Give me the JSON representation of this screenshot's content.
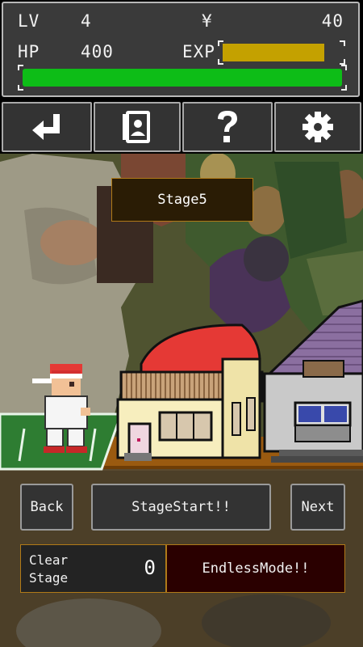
{
  "status": {
    "lv_label": "LV",
    "lv_value": "4",
    "currency_symbol": "¥",
    "gold_value": "40",
    "hp_label": "HP",
    "hp_value": "400",
    "exp_label": "EXP",
    "exp_fraction": 0.86,
    "hp_fraction": 1.0,
    "hp_color": "#0dbd17",
    "exp_color": "#c4a100"
  },
  "toolbar": {
    "icons": [
      "return-arrow-icon",
      "profile-card-icon",
      "question-mark-icon",
      "gear-icon"
    ]
  },
  "stage": {
    "label": "Stage5"
  },
  "controls": {
    "back_label": "Back",
    "start_label": "StageStart!!",
    "next_label": "Next",
    "clear_label": "Clear\nStage",
    "clear_value": "0",
    "endless_label": "EndlessMode!!"
  }
}
